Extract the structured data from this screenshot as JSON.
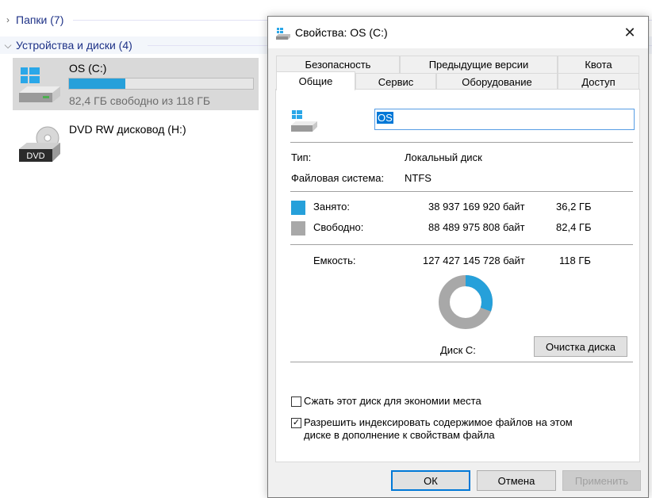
{
  "explorer": {
    "folders_header": "Папки (7)",
    "devices_header": "Устройства и диски (4)",
    "drives": [
      {
        "name": "OS (C:)",
        "free_text": "82,4 ГБ свободно из 118 ГБ",
        "used_fraction": 0.305
      },
      {
        "name": "DVD RW дисковод (H:)",
        "icon_label": "DVD"
      }
    ]
  },
  "dialog": {
    "title": "Свойства: OS (C:)",
    "close_glyph": "✕",
    "tabs_back": [
      "Безопасность",
      "Предыдущие версии",
      "Квота"
    ],
    "tabs_front": [
      "Общие",
      "Сервис",
      "Оборудование",
      "Доступ"
    ],
    "active_tab": "Общие",
    "general": {
      "name_value": "OS",
      "type_label": "Тип:",
      "type_value": "Локальный диск",
      "fs_label": "Файловая система:",
      "fs_value": "NTFS",
      "used_label": "Занято:",
      "used_bytes": "38 937 169 920 байт",
      "used_size": "36,2 ГБ",
      "free_label": "Свободно:",
      "free_bytes": "88 489 975 808 байт",
      "free_size": "82,4 ГБ",
      "capacity_label": "Емкость:",
      "capacity_bytes": "127 427 145 728 байт",
      "capacity_size": "118 ГБ",
      "disk_label": "Диск C:",
      "cleanup_button": "Очистка диска",
      "compress_label": "Сжать этот диск для экономии места",
      "compress_checked": false,
      "index_label_line1": "Разрешить индексировать содержимое файлов на этом",
      "index_label_line2": "диске в дополнение к свойствам файла",
      "index_checked": true,
      "used_fraction": 0.3056
    },
    "buttons": {
      "ok": "ОК",
      "cancel": "Отмена",
      "apply": "Применить"
    },
    "colors": {
      "used": "#26a0da",
      "free": "#a8a8a8",
      "accent": "#0078d7"
    }
  }
}
